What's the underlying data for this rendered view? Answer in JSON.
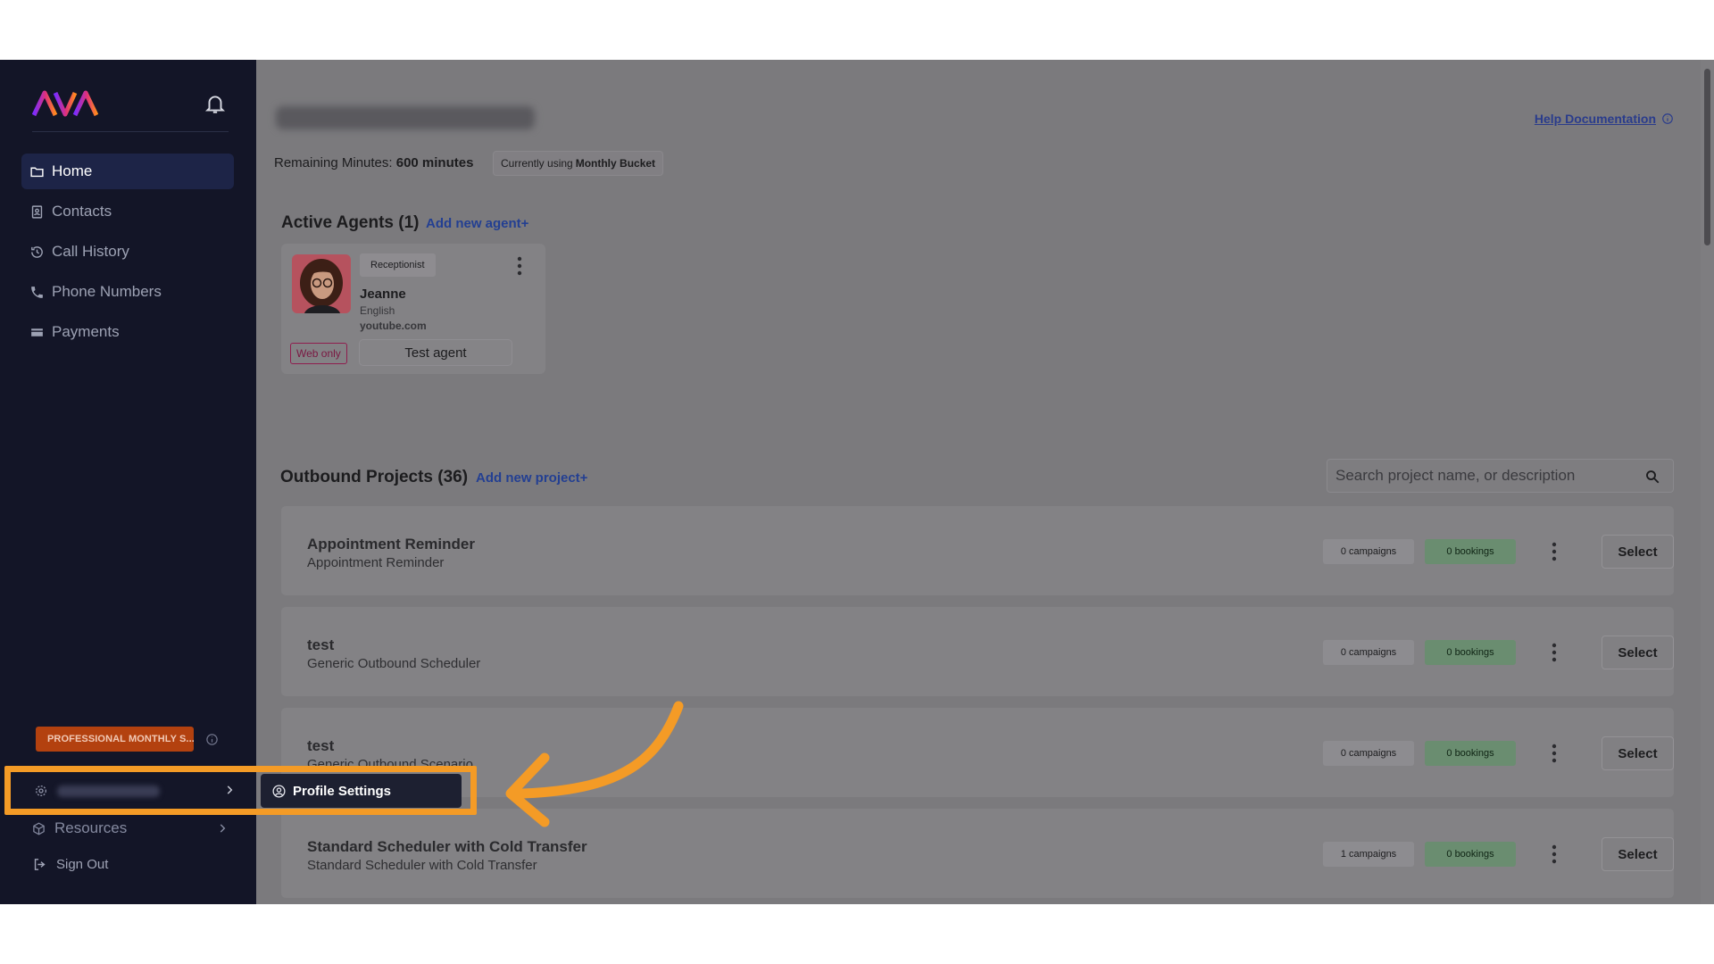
{
  "sidebar": {
    "nav": [
      {
        "label": "Home",
        "icon": "folder-icon",
        "active": true
      },
      {
        "label": "Contacts",
        "icon": "contact-book-icon",
        "active": false
      },
      {
        "label": "Call History",
        "icon": "history-icon",
        "active": false
      },
      {
        "label": "Phone Numbers",
        "icon": "phone-icon",
        "active": false
      },
      {
        "label": "Payments",
        "icon": "card-icon",
        "active": false
      }
    ],
    "plan_badge": "PROFESSIONAL MONTHLY S...",
    "profile_popup": "Profile Settings",
    "resources": "Resources",
    "sign_out": "Sign Out"
  },
  "header": {
    "help_link": "Help Documentation",
    "remaining_label": "Remaining Minutes:",
    "remaining_value": "600 minutes",
    "bucket_prefix": "Currently using",
    "bucket_value": "Monthly Bucket"
  },
  "agents": {
    "title": "Active Agents (1)",
    "add_link": "Add new agent+",
    "card": {
      "tag": "Receptionist",
      "name": "Jeanne",
      "language": "English",
      "site": "youtube.com",
      "mode": "Web only",
      "test_button": "Test agent"
    }
  },
  "projects": {
    "title": "Outbound Projects (36)",
    "add_link": "Add new project+",
    "search_placeholder": "Search project name, or description",
    "select_label": "Select",
    "items": [
      {
        "name": "Appointment Reminder",
        "desc": "Appointment Reminder",
        "campaigns": "0 campaigns",
        "bookings": "0 bookings"
      },
      {
        "name": "test",
        "desc": "Generic Outbound Scheduler",
        "campaigns": "0 campaigns",
        "bookings": "0 bookings"
      },
      {
        "name": "test",
        "desc": "Generic Outbound Scenario",
        "campaigns": "0 campaigns",
        "bookings": "0 bookings"
      },
      {
        "name": "Standard Scheduler with Cold Transfer",
        "desc": "Standard Scheduler with Cold Transfer",
        "campaigns": "1 campaigns",
        "bookings": "0 bookings"
      }
    ]
  },
  "colors": {
    "sidebar_bg": "#131527",
    "overlay_bg": "#7b7a7d",
    "highlight": "#f49b26",
    "plan_badge": "#b3410f",
    "link": "#233f92"
  }
}
